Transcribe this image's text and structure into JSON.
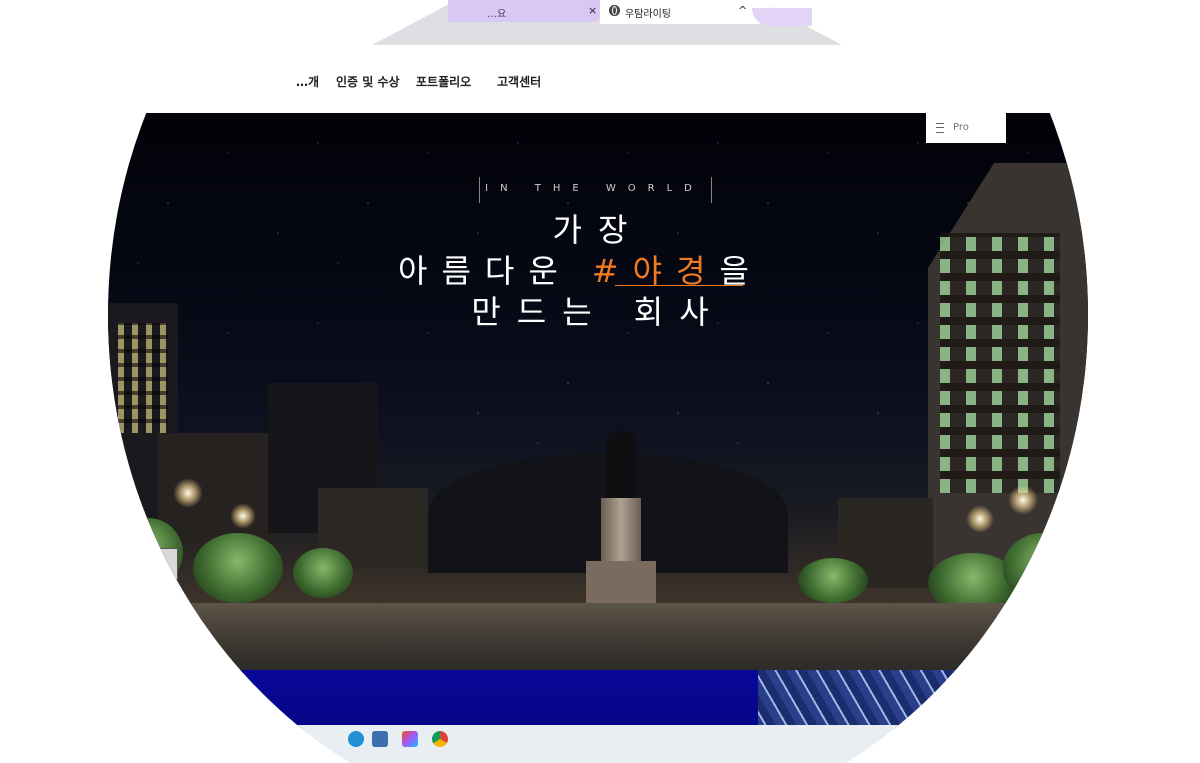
{
  "browser": {
    "tabs": [
      {
        "label": "…요",
        "active": false
      },
      {
        "label": "우탐라이팅",
        "active": true
      }
    ],
    "close_glyph": "×",
    "chevron_glyph": "^"
  },
  "nav": {
    "items": [
      "…개",
      "인증 및 수상",
      "포트폴리오",
      "고객센터"
    ]
  },
  "hero": {
    "tagline": "IN THE WORLD",
    "line1": "가장",
    "line2_prefix": "아름다운",
    "line2_accent": "#야경",
    "line2_suffix": "을",
    "line3": "만드는 회사",
    "accent_color": "#f07a22"
  },
  "side_button": {
    "icon": "list-icon",
    "label": "Pro"
  },
  "taskbar": {
    "icons": [
      "edge-icon",
      "photo-icon",
      "figma-icon",
      "chrome-icon"
    ]
  }
}
